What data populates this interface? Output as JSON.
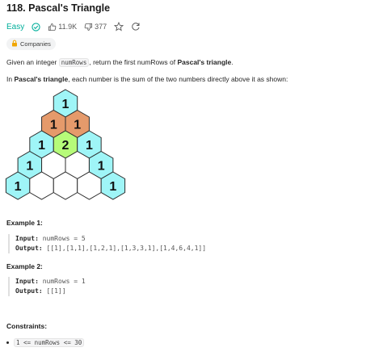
{
  "problem": {
    "title": "118. Pascal's Triangle",
    "difficulty": "Easy",
    "likes": "11.9K",
    "dislikes": "377",
    "companies_label": "Companies"
  },
  "description": {
    "p1_pre": "Given an integer ",
    "p1_code": "numRows",
    "p1_mid": ", return the first numRows of ",
    "p1_bold": "Pascal's triangle",
    "p1_end": ".",
    "p2_pre": "In ",
    "p2_bold": "Pascal's triangle",
    "p2_rest": ", each number is the sum of the two numbers directly above it as shown:"
  },
  "illustration": {
    "rows": [
      [
        "1"
      ],
      [
        "1",
        "1"
      ],
      [
        "1",
        "2",
        "1"
      ],
      [
        "1",
        "",
        "",
        "1"
      ],
      [
        "1",
        "",
        "",
        "",
        "1"
      ]
    ],
    "colors": {
      "edge": "#9ff5f7",
      "source": "#e59a6b",
      "sum": "#b6fb79",
      "blank": "#ffffff",
      "stroke": "#2c2c2c"
    }
  },
  "examples": [
    {
      "heading": "Example 1:",
      "input_label": "Input:",
      "input_value": "numRows = 5",
      "output_label": "Output:",
      "output_value": "[[1],[1,1],[1,2,1],[1,3,3,1],[1,4,6,4,1]]"
    },
    {
      "heading": "Example 2:",
      "input_label": "Input:",
      "input_value": "numRows = 1",
      "output_label": "Output:",
      "output_value": "[[1]]"
    }
  ],
  "constraints": {
    "heading": "Constraints:",
    "items": [
      "1 <= numRows <= 30"
    ]
  },
  "theme": {
    "easy": "#00af9b",
    "icon": "#595959"
  }
}
